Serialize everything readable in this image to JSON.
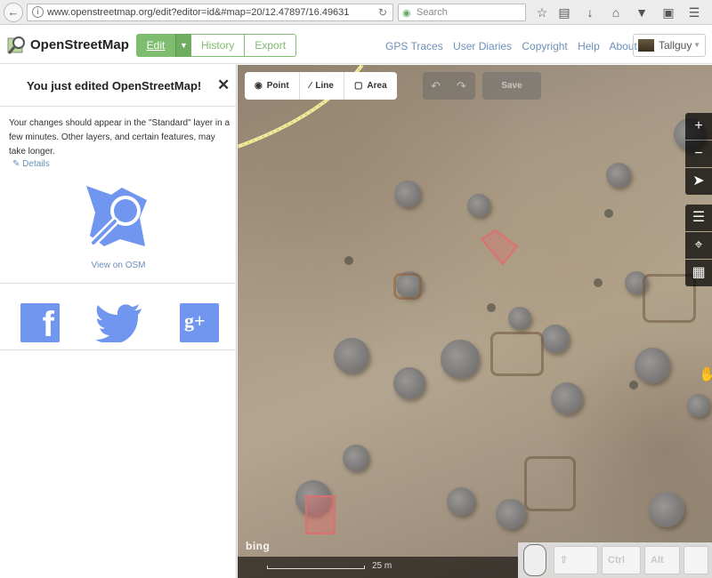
{
  "browser": {
    "url": "www.openstreetmap.org/edit?editor=id&#map=20/12.47897/16.49631",
    "search_placeholder": "Search"
  },
  "header": {
    "site_name": "OpenStreetMap",
    "tabs": {
      "edit": "Edit",
      "history": "History",
      "export": "Export"
    },
    "nav": [
      "GPS Traces",
      "User Diaries",
      "Copyright",
      "Help",
      "About"
    ],
    "user": "Tallguy"
  },
  "sidebar": {
    "title": "You just edited OpenStreetMap!",
    "message": "Your changes should appear in the \"Standard\" layer in a few minutes. Other layers, and certain features, may take longer.",
    "details_link": "Details",
    "view_link": "View on OSM",
    "share": [
      "facebook-icon",
      "twitter-icon",
      "google-plus-icon"
    ]
  },
  "editor": {
    "tools": {
      "point": "Point",
      "line": "Line",
      "area": "Area"
    },
    "save": "Save",
    "imagery_label": "bing",
    "scale_label": "25 m",
    "keys": {
      "ctrl": "Ctrl",
      "alt": "Alt"
    }
  },
  "colors": {
    "accent": "#7ebc6f",
    "link": "#6b8fb8",
    "share": "#7096f0"
  }
}
